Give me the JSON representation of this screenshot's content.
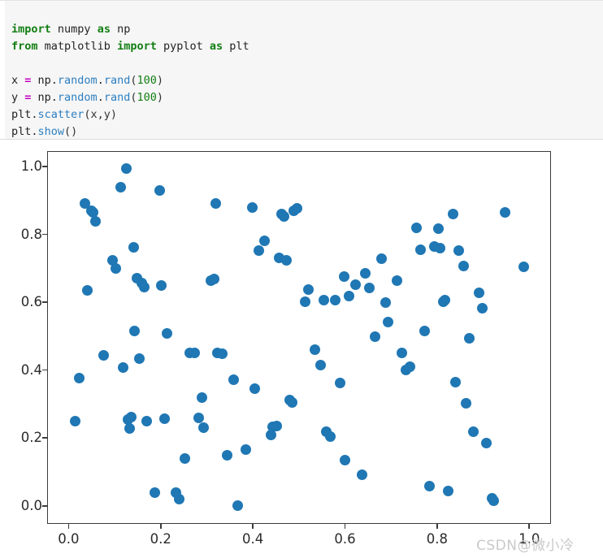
{
  "code_cell": {
    "background_color": "#f6f6f6",
    "language": "python",
    "lines": [
      [
        {
          "t": "import",
          "c": "kw"
        },
        {
          "t": " numpy ",
          "c": "name"
        },
        {
          "t": "as",
          "c": "kw"
        },
        {
          "t": " np",
          "c": "name"
        }
      ],
      [
        {
          "t": "from",
          "c": "kw"
        },
        {
          "t": " matplotlib ",
          "c": "name"
        },
        {
          "t": "import",
          "c": "kw"
        },
        {
          "t": " pyplot ",
          "c": "name"
        },
        {
          "t": "as",
          "c": "kw"
        },
        {
          "t": " plt",
          "c": "name"
        }
      ],
      [],
      [
        {
          "t": "x ",
          "c": "name"
        },
        {
          "t": "=",
          "c": "op"
        },
        {
          "t": " np.",
          "c": "name"
        },
        {
          "t": "random",
          "c": "fn"
        },
        {
          "t": ".",
          "c": "name"
        },
        {
          "t": "rand",
          "c": "fn"
        },
        {
          "t": "(",
          "c": "punc"
        },
        {
          "t": "100",
          "c": "num"
        },
        {
          "t": ")",
          "c": "punc"
        }
      ],
      [
        {
          "t": "y ",
          "c": "name"
        },
        {
          "t": "=",
          "c": "op"
        },
        {
          "t": " np.",
          "c": "name"
        },
        {
          "t": "random",
          "c": "fn"
        },
        {
          "t": ".",
          "c": "name"
        },
        {
          "t": "rand",
          "c": "fn"
        },
        {
          "t": "(",
          "c": "punc"
        },
        {
          "t": "100",
          "c": "num"
        },
        {
          "t": ")",
          "c": "punc"
        }
      ],
      [
        {
          "t": "plt.",
          "c": "name"
        },
        {
          "t": "scatter",
          "c": "fn"
        },
        {
          "t": "(x,y)",
          "c": "punc"
        }
      ],
      [
        {
          "t": "plt.",
          "c": "name"
        },
        {
          "t": "show",
          "c": "fn"
        },
        {
          "t": "()",
          "c": "punc"
        }
      ]
    ]
  },
  "watermark": {
    "text": "CSDN@微小冷",
    "color": "#c9c9c9"
  },
  "chart_data": {
    "type": "scatter",
    "title": "",
    "xlabel": "",
    "ylabel": "",
    "xlim": [
      -0.0466,
      1.0437
    ],
    "ylim": [
      -0.0485,
      1.0458
    ],
    "grid": false,
    "legend": null,
    "marker_color": "#1f77b4",
    "marker_size_px": 13,
    "n_points": 100,
    "xticks": [
      0.0,
      0.2,
      0.4,
      0.6,
      0.8,
      1.0
    ],
    "xtick_labels": [
      "0.0",
      "0.2",
      "0.4",
      "0.6",
      "0.8",
      "1.0"
    ],
    "yticks": [
      0.0,
      0.2,
      0.4,
      0.6,
      0.8,
      1.0
    ],
    "ytick_labels": [
      "0.0",
      "0.2",
      "0.4",
      "0.6",
      "0.8",
      "1.0"
    ],
    "points": [
      [
        0.012,
        0.251
      ],
      [
        0.022,
        0.38
      ],
      [
        0.033,
        0.893
      ],
      [
        0.039,
        0.637
      ],
      [
        0.047,
        0.872
      ],
      [
        0.052,
        0.868
      ],
      [
        0.057,
        0.84
      ],
      [
        0.074,
        0.445
      ],
      [
        0.093,
        0.727
      ],
      [
        0.1,
        0.703
      ],
      [
        0.112,
        0.942
      ],
      [
        0.117,
        0.409
      ],
      [
        0.123,
        0.996
      ],
      [
        0.128,
        0.257
      ],
      [
        0.13,
        0.231
      ],
      [
        0.134,
        0.263
      ],
      [
        0.139,
        0.765
      ],
      [
        0.142,
        0.518
      ],
      [
        0.147,
        0.673
      ],
      [
        0.152,
        0.437
      ],
      [
        0.158,
        0.66
      ],
      [
        0.162,
        0.648
      ],
      [
        0.168,
        0.252
      ],
      [
        0.186,
        0.042
      ],
      [
        0.196,
        0.932
      ],
      [
        0.199,
        0.653
      ],
      [
        0.206,
        0.259
      ],
      [
        0.212,
        0.51
      ],
      [
        0.232,
        0.041
      ],
      [
        0.239,
        0.022
      ],
      [
        0.251,
        0.143
      ],
      [
        0.262,
        0.454
      ],
      [
        0.272,
        0.452
      ],
      [
        0.281,
        0.262
      ],
      [
        0.288,
        0.322
      ],
      [
        0.292,
        0.233
      ],
      [
        0.308,
        0.667
      ],
      [
        0.314,
        0.672
      ],
      [
        0.318,
        0.893
      ],
      [
        0.322,
        0.453
      ],
      [
        0.331,
        0.451
      ],
      [
        0.342,
        0.151
      ],
      [
        0.356,
        0.375
      ],
      [
        0.366,
        0.002
      ],
      [
        0.383,
        0.169
      ],
      [
        0.397,
        0.881
      ],
      [
        0.403,
        0.347
      ],
      [
        0.411,
        0.755
      ],
      [
        0.424,
        0.783
      ],
      [
        0.437,
        0.212
      ],
      [
        0.442,
        0.236
      ],
      [
        0.45,
        0.237
      ],
      [
        0.456,
        0.733
      ],
      [
        0.461,
        0.863
      ],
      [
        0.466,
        0.855
      ],
      [
        0.471,
        0.726
      ],
      [
        0.478,
        0.314
      ],
      [
        0.484,
        0.308
      ],
      [
        0.487,
        0.873
      ],
      [
        0.494,
        0.88
      ],
      [
        0.512,
        0.605
      ],
      [
        0.519,
        0.639
      ],
      [
        0.533,
        0.463
      ],
      [
        0.546,
        0.418
      ],
      [
        0.552,
        0.61
      ],
      [
        0.558,
        0.221
      ],
      [
        0.566,
        0.207
      ],
      [
        0.577,
        0.61
      ],
      [
        0.588,
        0.364
      ],
      [
        0.596,
        0.678
      ],
      [
        0.599,
        0.136
      ],
      [
        0.607,
        0.621
      ],
      [
        0.622,
        0.655
      ],
      [
        0.635,
        0.094
      ],
      [
        0.642,
        0.688
      ],
      [
        0.651,
        0.644
      ],
      [
        0.663,
        0.5
      ],
      [
        0.678,
        0.73
      ],
      [
        0.686,
        0.601
      ],
      [
        0.692,
        0.543
      ],
      [
        0.711,
        0.666
      ],
      [
        0.722,
        0.453
      ],
      [
        0.731,
        0.403
      ],
      [
        0.74,
        0.413
      ],
      [
        0.754,
        0.822
      ],
      [
        0.762,
        0.758
      ],
      [
        0.771,
        0.517
      ],
      [
        0.781,
        0.06
      ],
      [
        0.793,
        0.766
      ],
      [
        0.801,
        0.82
      ],
      [
        0.805,
        0.762
      ],
      [
        0.811,
        0.604
      ],
      [
        0.816,
        0.608
      ],
      [
        0.822,
        0.045
      ],
      [
        0.833,
        0.862
      ],
      [
        0.839,
        0.366
      ],
      [
        0.846,
        0.755
      ],
      [
        0.856,
        0.71
      ],
      [
        0.861,
        0.304
      ],
      [
        0.869,
        0.496
      ],
      [
        0.877,
        0.22
      ],
      [
        0.889,
        0.63
      ],
      [
        0.896,
        0.584
      ],
      [
        0.905,
        0.188
      ],
      [
        0.917,
        0.024
      ],
      [
        0.921,
        0.018
      ],
      [
        0.946,
        0.868
      ],
      [
        0.987,
        0.707
      ]
    ]
  }
}
